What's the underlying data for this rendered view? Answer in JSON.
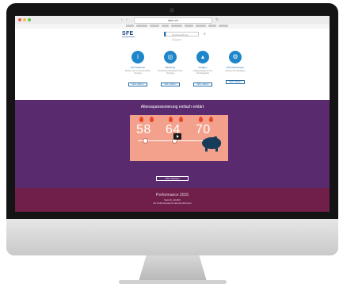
{
  "browser": {
    "url": "sfee.ch"
  },
  "site": {
    "logo": "SFE",
    "search_placeholder": "Suchbegriff hier eingeben"
  },
  "services": [
    {
      "title": "Informationen",
      "text": "Wissen rund um die berufliche Vorsorge",
      "button": "Mehr erfahren",
      "icon": "info-icon"
    },
    {
      "title": "Beratung",
      "text": "Persönliche Beratung für Ihre Vorsorge",
      "button": "Mehr erfahren",
      "icon": "globe-icon"
    },
    {
      "title": "Anlagen",
      "text": "Anlagestrategie für Ihre Vorsorgegelder",
      "button": "Mehr erfahren",
      "icon": "chart-icon"
    },
    {
      "title": "Dienstleistungen",
      "text": "Services für Arbeitgeber",
      "button": "Mehr erfahren",
      "icon": "gear-icon"
    }
  ],
  "video": {
    "title": "Altersspansionierung einfach erklärt",
    "numbers": [
      "58",
      "64",
      "70"
    ],
    "button": "Video abspielen"
  },
  "performance": {
    "title": "Performance 2015",
    "line1": "Stand 31. Juli 2015",
    "line2": "Der Performancebericht steht ab sofort bereit"
  },
  "colors": {
    "primary_blue": "#1f86c9",
    "purple": "#5a2a6e",
    "maroon": "#6f1f49",
    "salmon": "#f3a18c"
  }
}
